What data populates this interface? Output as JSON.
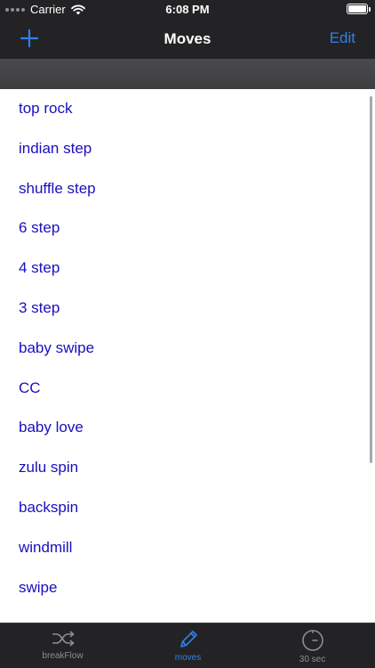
{
  "status_bar": {
    "carrier": "Carrier",
    "time": "6:08 PM",
    "icons": [
      "signal-dots-icon",
      "wifi-icon",
      "battery-icon"
    ]
  },
  "nav": {
    "title": "Moves",
    "add_icon": "plus-icon",
    "edit_label": "Edit"
  },
  "moves": [
    "top rock",
    "indian step",
    "shuffle step",
    "6 step",
    "4 step",
    "3 step",
    "baby swipe",
    "CC",
    "baby love",
    "zulu spin",
    "backspin",
    "windmill",
    "swipe"
  ],
  "tabs": [
    {
      "label": "breakFlow",
      "icon": "shuffle-icon",
      "selected": false
    },
    {
      "label": "moves",
      "icon": "pencil-icon",
      "selected": true
    },
    {
      "label": "30 sec",
      "icon": "timer-icon",
      "selected": false
    }
  ],
  "colors": {
    "accent": "#2f80ed",
    "list_text": "#1a0fbf",
    "bar_background": "#232325",
    "inactive_tab": "#8e8e93"
  }
}
